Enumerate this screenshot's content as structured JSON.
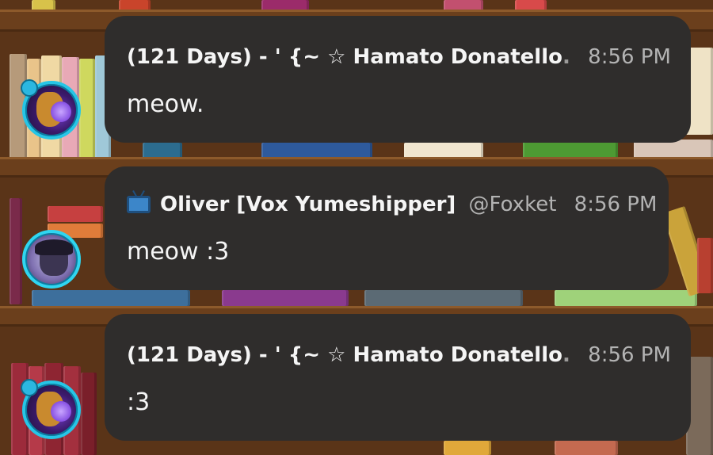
{
  "messages": [
    {
      "author": "(121 Days) - ' {~ ☆ Hamato Donatello",
      "author_tail": ".",
      "time": "8:56 PM",
      "text": "meow."
    },
    {
      "icon": "tv-icon",
      "author": "Oliver [Vox Yumeshipper]",
      "handle": "@Foxket",
      "time": "8:56 PM",
      "text": "meow :3"
    },
    {
      "author": "(121 Days) - ' {~ ☆ Hamato Donatello",
      "author_tail": ".",
      "time": "8:56 PM",
      "text": ":3"
    }
  ],
  "colors": {
    "bubble": "#2f2d2c",
    "avatar_ring": "#26c6e6",
    "timestamp": "#b3b3b3",
    "text": "#f5f5f5"
  }
}
